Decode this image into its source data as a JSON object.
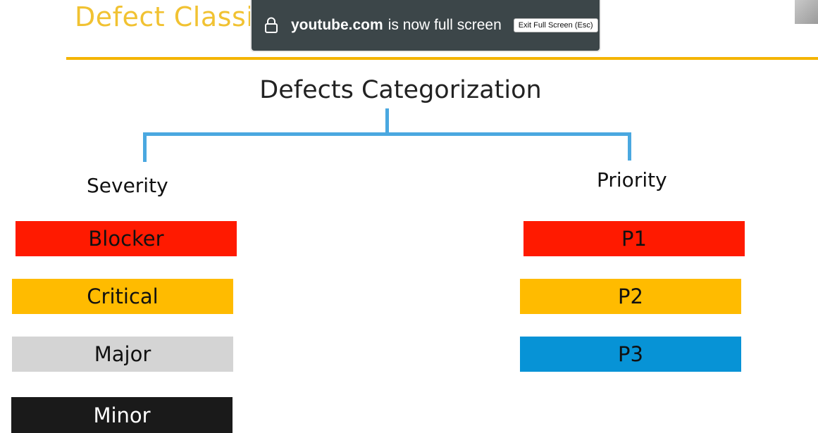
{
  "slide": {
    "title": "Defect Classification",
    "heading": "Defects Categorization"
  },
  "severity": {
    "label": "Severity",
    "levels": [
      {
        "label": "Blocker",
        "color": "#ff1a00",
        "text_color": "#111111"
      },
      {
        "label": "Critical",
        "color": "#ffbb00",
        "text_color": "#111111"
      },
      {
        "label": "Major",
        "color": "#d4d4d4",
        "text_color": "#111111"
      },
      {
        "label": "Minor",
        "color": "#1a1a1a",
        "text_color": "#ffffff"
      }
    ]
  },
  "priority": {
    "label": "Priority",
    "levels": [
      {
        "label": "P1",
        "color": "#ff1a00",
        "text_color": "#111111"
      },
      {
        "label": "P2",
        "color": "#ffbb00",
        "text_color": "#111111"
      },
      {
        "label": "P3",
        "color": "#0793d6",
        "text_color": "#111111"
      }
    ]
  },
  "fullscreen_notice": {
    "domain": "youtube.com",
    "message": "is now full screen",
    "exit_label": "Exit Full Screen (Esc)",
    "icon": "lock-icon"
  },
  "colors": {
    "title": "#f1c232",
    "rule": "#f4b400",
    "connector": "#4aa8e0",
    "banner_bg": "#3c4649"
  }
}
